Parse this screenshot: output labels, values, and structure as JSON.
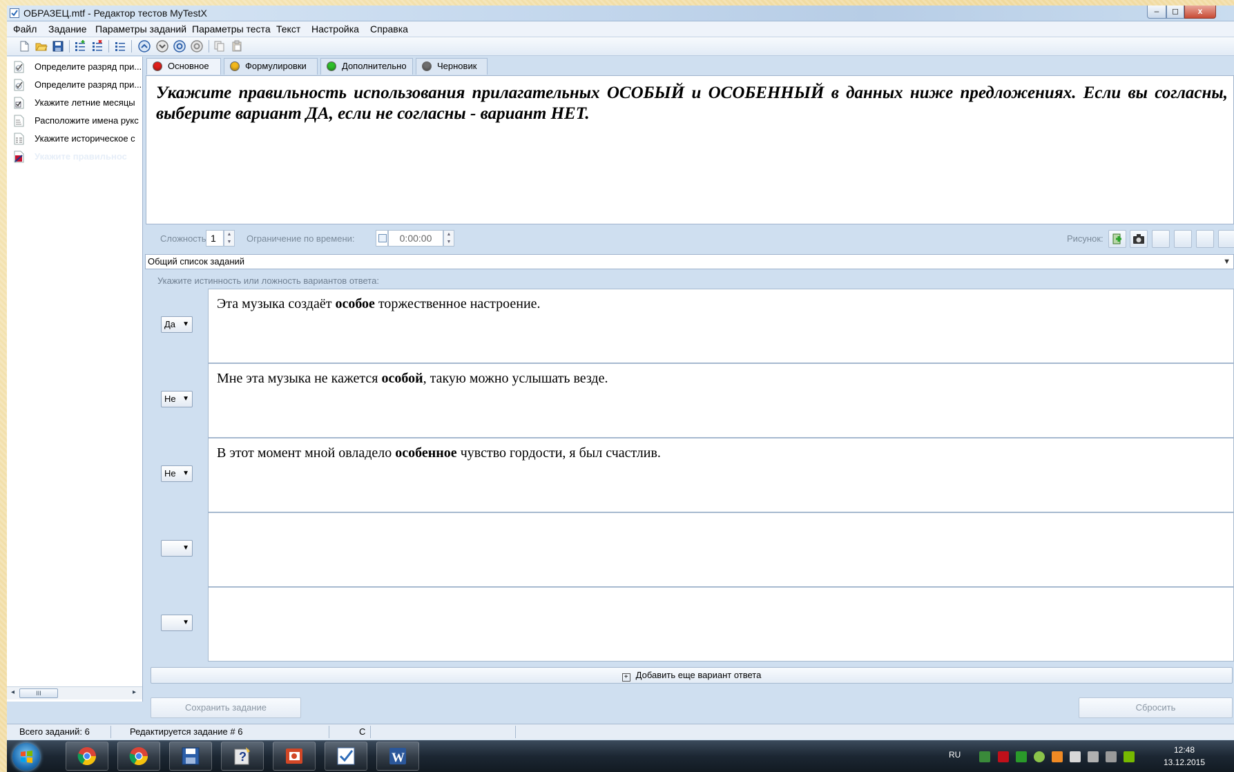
{
  "window": {
    "title": "ОБРАЗЕЦ.mtf - Редактор тестов MyTestX",
    "min_btn": "–",
    "max_btn": "◻",
    "close_btn": "x"
  },
  "menu": {
    "items": [
      "Файл",
      "Задание",
      "Параметры заданий",
      "Параметры теста",
      "Текст",
      "Настройка",
      "Справка"
    ]
  },
  "task_list": {
    "items": [
      {
        "label": "Определите разряд при...",
        "icon": "check-task-icon"
      },
      {
        "label": "Определите разряд при...",
        "icon": "check-task-icon"
      },
      {
        "label": "Укажите летние месяцы",
        "icon": "checkbox-task-icon"
      },
      {
        "label": "Расположите имена рукс",
        "icon": "order-task-icon"
      },
      {
        "label": "Укажите историческое с",
        "icon": "match-task-icon"
      },
      {
        "label": "Укажите правильнос",
        "icon": "yesno-task-icon"
      }
    ],
    "selected_index": 5,
    "scroll_thumb": "III"
  },
  "tabs": [
    {
      "label": "Основное",
      "color": "#e0201c",
      "active": true
    },
    {
      "label": "Формулировки",
      "color": "#f2b81c",
      "active": false
    },
    {
      "label": "Дополнительно",
      "color": "#2fbf2a",
      "active": false
    },
    {
      "label": "Черновик",
      "color": "#6e6e6e",
      "active": false
    }
  ],
  "question": {
    "text": "Укажите правильность использования прилагательных ОСОБЫЙ и ОСОБЕННЫЙ в данных ниже предложениях. Если вы согласны, выберите вариант ДА, если не согласны - вариант НЕТ."
  },
  "params": {
    "difficulty_label": "Сложность:",
    "difficulty_value": "1",
    "time_limit_label": "Ограничение по времени:",
    "time_value": "0:00:00",
    "picture_label": "Рисунок:"
  },
  "task_group": {
    "selected": "Общий список заданий"
  },
  "answers_hint": "Укажите истинность или ложность вариантов ответа:",
  "answers": [
    {
      "choice": "Да",
      "pre": "Эта музыка создаёт ",
      "bold": "особое",
      "post": " торжественное настроение."
    },
    {
      "choice": "Не",
      "pre": "Мне эта музыка не кажется ",
      "bold": "особой",
      "post": ", такую можно услышать везде."
    },
    {
      "choice": "Не",
      "pre": "В этот момент мной овладело ",
      "bold": "особенное",
      "post": " чувство гордости, я был счастлив."
    },
    {
      "choice": "",
      "pre": "",
      "bold": "",
      "post": ""
    },
    {
      "choice": "",
      "pre": "",
      "bold": "",
      "post": ""
    }
  ],
  "buttons": {
    "add_answer": "Добавить еще вариант ответа",
    "add_icon": "+",
    "save": "Сохранить задание",
    "reset": "Сбросить"
  },
  "status": {
    "total": "Всего заданий: 6",
    "editing": "Редактируется задание # 6",
    "mode": "C"
  },
  "taskbar": {
    "apps": [
      "chrome",
      "chrome",
      "save-disk",
      "help",
      "powerpoint",
      "mytestx",
      "word"
    ],
    "lang": "RU",
    "time": "12:48",
    "date": "13.12.2015"
  }
}
